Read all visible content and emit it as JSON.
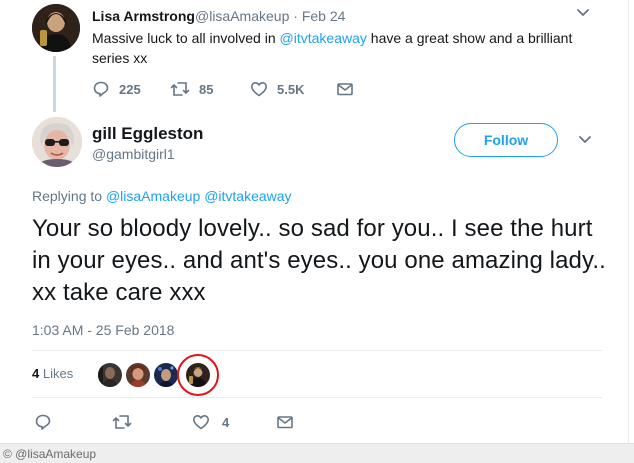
{
  "parent_tweet": {
    "name": "Lisa Armstrong",
    "handle": "@lisaAmakeup",
    "separator": "·",
    "date": "Feb 24",
    "text_before": "Massive luck to all involved in ",
    "mention": "@itvtakeaway",
    "text_after": " have a great show and a brilliant series xx",
    "actions": {
      "replies": "225",
      "retweets": "85",
      "likes": "5.5K"
    }
  },
  "main_tweet": {
    "name": "gill Eggleston",
    "handle": "@gambitgirl1",
    "follow_label": "Follow",
    "replying_label": "Replying to",
    "replying_mention_1": "@lisaAmakeup",
    "replying_mention_2": "@itvtakeaway",
    "text": "Your so bloody lovely.. so sad for you.. I see the hurt in your eyes.. and ant's eyes.. you one amazing lady.. xx take care xxx",
    "timestamp": "1:03 AM - 25 Feb 2018",
    "likes_count": "4",
    "likes_label": "Likes",
    "actions": {
      "likes": "4"
    }
  },
  "footer": {
    "credit": "© @lisaAmakeup"
  },
  "colors": {
    "accent": "#1da1f2",
    "secondary_text": "#657786",
    "highlight_ring": "#e0141b"
  }
}
